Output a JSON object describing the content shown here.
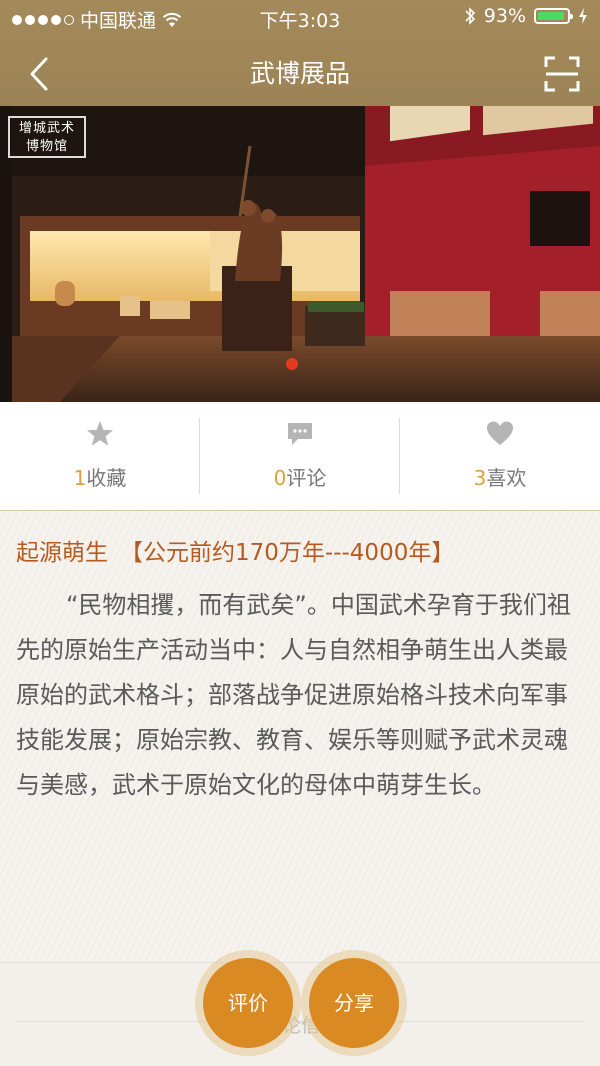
{
  "status_bar": {
    "carrier": "中国联通",
    "time": "下午3:03",
    "battery_percent": "93%",
    "battery_level": 0.93
  },
  "nav": {
    "title": "武博展品",
    "back_icon": "chevron-left-icon",
    "scan_icon": "scan-icon"
  },
  "hero": {
    "logo_text_line1": "增城武术",
    "logo_text_line2": "博物馆",
    "pager_color": "#e43b20"
  },
  "stats": [
    {
      "icon": "star-icon",
      "count": "1",
      "label": "收藏"
    },
    {
      "icon": "comment-icon",
      "count": "0",
      "label": "评论"
    },
    {
      "icon": "heart-icon",
      "count": "3",
      "label": "喜欢"
    }
  ],
  "content": {
    "heading_title": "起源萌生",
    "heading_period": "【公元前约170万年---4000年】",
    "paragraph": "“民物相攫，而有武矣”。中国武术孕育于我们祖先的原始生产活动当中：人与自然相争萌生出人类最原始的武术格斗；部落战争促进原始格斗技术向军事技能发展；原始宗教、教育、娱乐等则赋予武术灵魂与美感，武术于原始文化的母体中萌芽生长。"
  },
  "lower": {
    "partial_text": "论信"
  },
  "actions": {
    "rate_label": "评价",
    "share_label": "分享"
  },
  "colors": {
    "nav_bg": "#a48a5a",
    "accent": "#d98a22",
    "heading": "#b55a20",
    "count": "#e0a13a"
  }
}
